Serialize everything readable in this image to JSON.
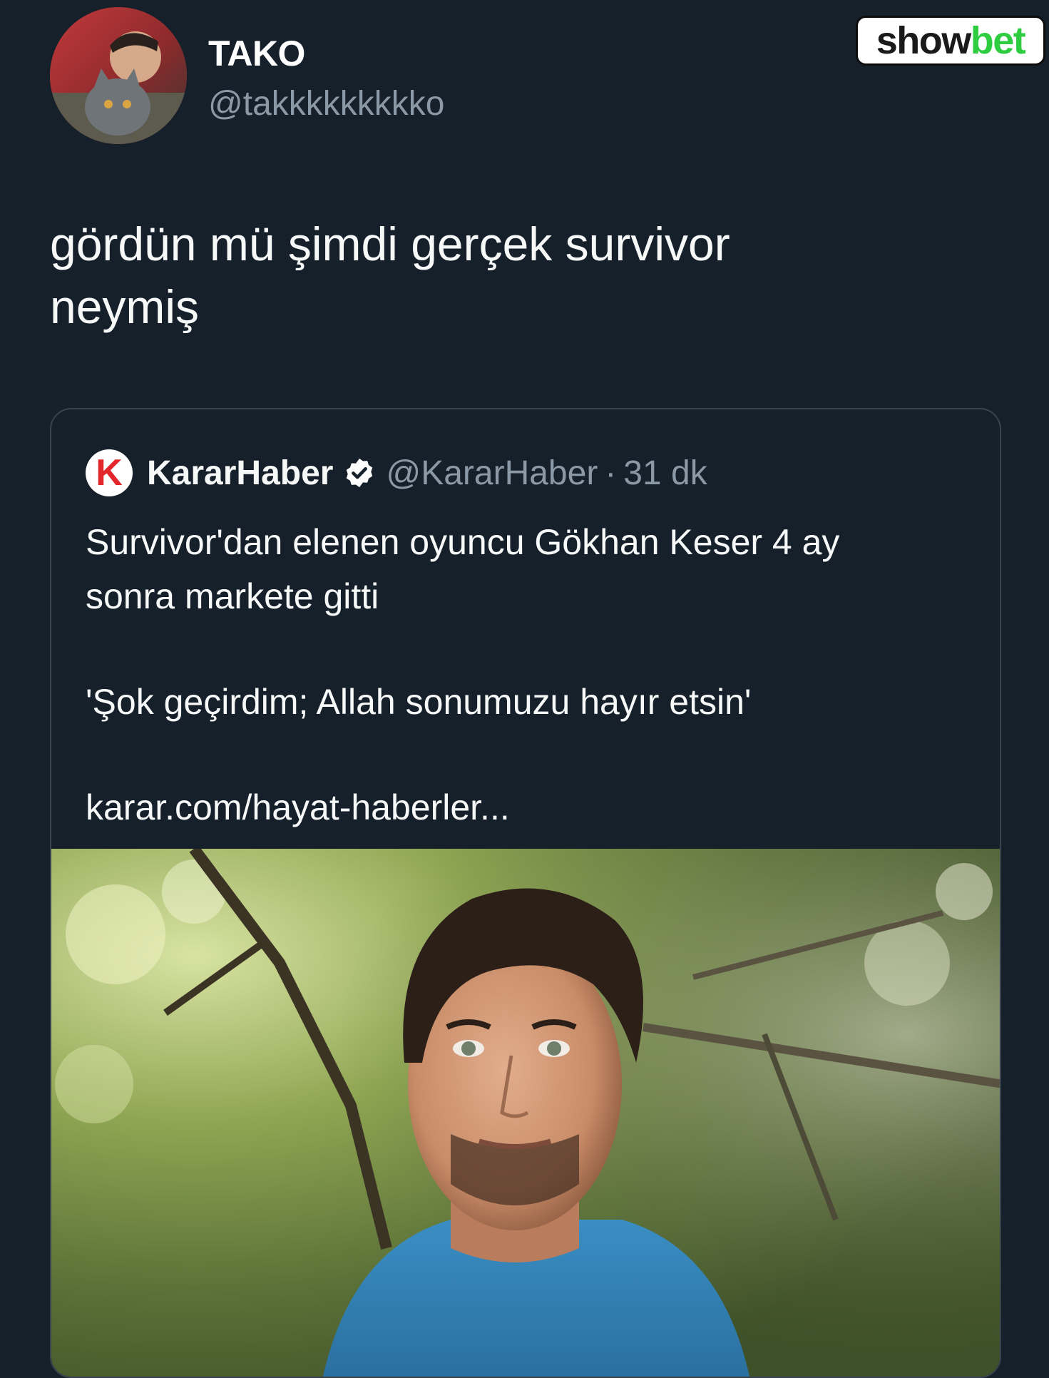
{
  "author": {
    "name": "TAKO",
    "handle": "@takkkkkkkkko",
    "avatar_icon": "profile-photo"
  },
  "brand": {
    "part1": "show",
    "part2": "bet",
    "accent": "#2ecc40"
  },
  "tweet": {
    "text_line1": "gördün mü şimdi gerçek survivor",
    "text_line2": "neymiş"
  },
  "quoted": {
    "logo_letter": "K",
    "name": "KararHaber",
    "verified_icon": "verified-badge-icon",
    "handle": "@KararHaber",
    "separator": "·",
    "time": "31 dk",
    "headline_line1": "Survivor'dan elenen oyuncu Gökhan Keser 4 ay",
    "headline_line2": "sonra markete gitti",
    "quote": "'Şok geçirdim; Allah sonumuzu hayır etsin'",
    "link": "karar.com/hayat-haberler..."
  },
  "colors": {
    "background": "#15202b",
    "secondary_text": "#8b98a5",
    "border": "#38444d",
    "logo_red": "#e3262b"
  }
}
